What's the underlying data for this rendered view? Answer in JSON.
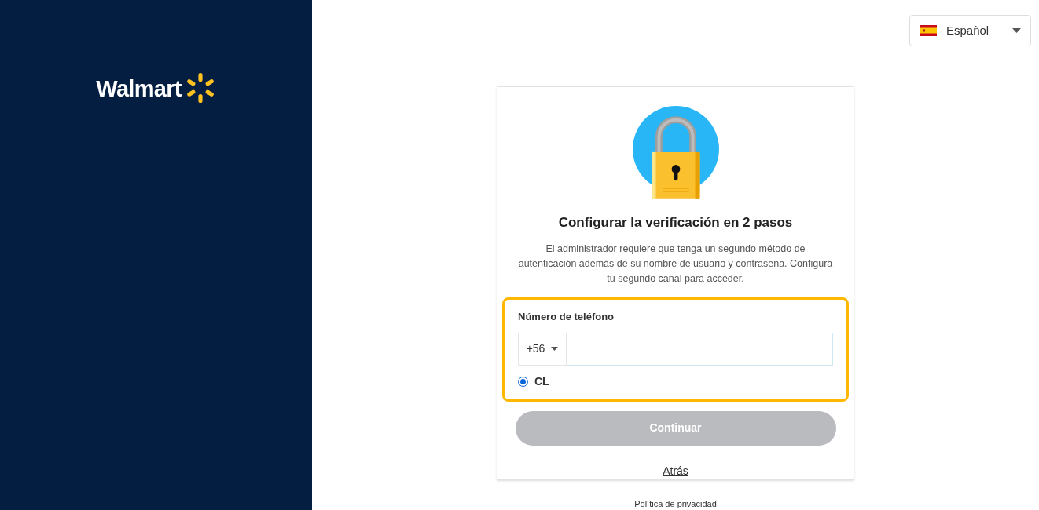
{
  "brand": {
    "name": "Walmart"
  },
  "language": {
    "label": "Español"
  },
  "card": {
    "title": "Configurar la verificación en 2 pasos",
    "description": "El administrador requiere que tenga un segundo método de autenticación además de su nombre de usuario y contraseña. Configura tu segundo canal para acceder.",
    "phone": {
      "label": "Número de teléfono",
      "country_code": "+56",
      "highlighted": true,
      "countries": [
        {
          "label": "CL",
          "selected": true
        }
      ]
    },
    "continue": {
      "label": "Continuar",
      "disabled": true
    },
    "back": {
      "label": "Atrás"
    }
  },
  "footer": {
    "privacy": "Política de privacidad"
  }
}
